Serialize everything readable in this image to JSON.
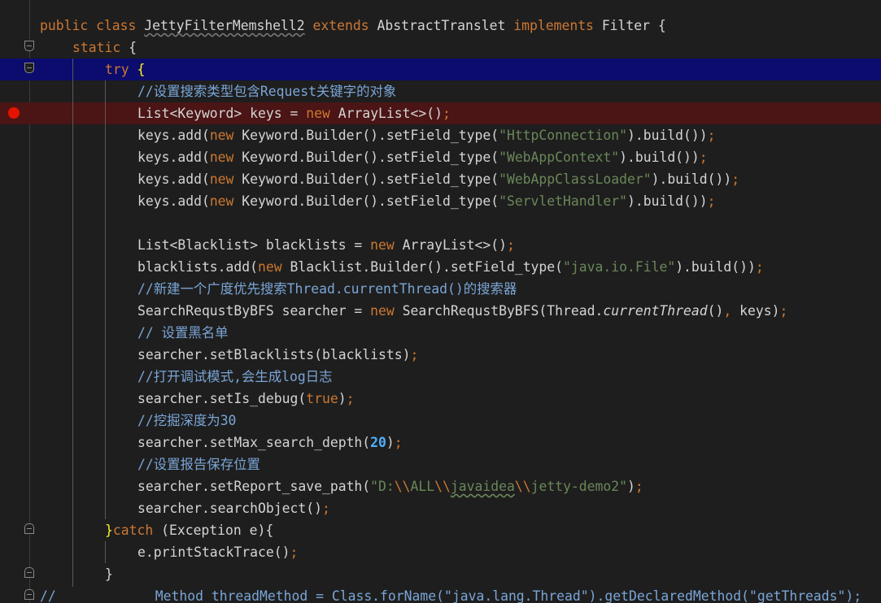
{
  "editor": {
    "lines": [
      {
        "id": "l1",
        "parts": [
          "public class ",
          "JettyFilterMemshell2",
          " extends ",
          "AbstractTranslet ",
          "implements ",
          "Filter {"
        ]
      },
      {
        "id": "l2",
        "parts": [
          "static ",
          "{"
        ]
      },
      {
        "id": "l3",
        "parts": [
          "try ",
          "{"
        ]
      },
      {
        "id": "l4",
        "parts": [
          "//设置搜索类型包含Request关键字的对象"
        ]
      },
      {
        "id": "l5",
        "parts": [
          "List<Keyword> keys = ",
          "new ",
          "ArrayList<>()",
          ";"
        ]
      },
      {
        "id": "l6",
        "parts": [
          "keys.add(",
          "new ",
          "Keyword.Builder().setField_type(",
          "\"HttpConnection\"",
          ").build())",
          ";"
        ]
      },
      {
        "id": "l7",
        "parts": [
          "keys.add(",
          "new ",
          "Keyword.Builder().setField_type(",
          "\"WebAppContext\"",
          ").build())",
          ";"
        ]
      },
      {
        "id": "l8",
        "parts": [
          "keys.add(",
          "new ",
          "Keyword.Builder().setField_type(",
          "\"WebAppClassLoader\"",
          ").build())",
          ";"
        ]
      },
      {
        "id": "l9",
        "parts": [
          "keys.add(",
          "new ",
          "Keyword.Builder().setField_type(",
          "\"ServletHandler\"",
          ").build())",
          ";"
        ]
      },
      {
        "id": "l11",
        "parts": [
          "List<Blacklist> blacklists = ",
          "new ",
          "ArrayList<>()",
          ";"
        ]
      },
      {
        "id": "l12",
        "parts": [
          "blacklists.add(",
          "new ",
          "Blacklist.Builder().setField_type(",
          "\"java.io.File\"",
          ").build())",
          ";"
        ]
      },
      {
        "id": "l13",
        "parts": [
          "//新建一个广度优先搜索Thread.currentThread()的搜索器"
        ]
      },
      {
        "id": "l14",
        "parts": [
          "SearchRequstByBFS searcher = ",
          "new ",
          "SearchRequstByBFS(Thread.",
          "currentThread",
          "()",
          ", ",
          "keys)",
          ";"
        ]
      },
      {
        "id": "l15",
        "parts": [
          "// 设置黑名单"
        ]
      },
      {
        "id": "l16",
        "parts": [
          "searcher.setBlacklists(blacklists)",
          ";"
        ]
      },
      {
        "id": "l17",
        "parts": [
          "//打开调试模式,会生成log日志"
        ]
      },
      {
        "id": "l18",
        "parts": [
          "searcher.setIs_debug(",
          "true",
          ")",
          ";"
        ]
      },
      {
        "id": "l19",
        "parts": [
          "//挖掘深度为30"
        ]
      },
      {
        "id": "l20",
        "parts": [
          "searcher.setMax_search_depth(",
          "20",
          ")",
          ";"
        ]
      },
      {
        "id": "l21",
        "parts": [
          "//设置报告保存位置"
        ]
      },
      {
        "id": "l22",
        "parts": [
          "searcher.setReport_save_path(",
          "\"D:",
          "\\\\",
          "ALL",
          "\\\\",
          "javaidea",
          "\\\\",
          "jetty-demo2\"",
          ")",
          ";"
        ]
      },
      {
        "id": "l23",
        "parts": [
          "searcher.searchObject()",
          ";"
        ]
      },
      {
        "id": "l24",
        "parts": [
          "}",
          "catch ",
          "(Exception e){"
        ]
      },
      {
        "id": "l25",
        "parts": [
          "e.printStackTrace()",
          ";"
        ]
      },
      {
        "id": "l26",
        "parts": [
          "}"
        ]
      },
      {
        "id": "l27",
        "parts": [
          "//",
          "Method threadMethod = Class.forName(\"java.lang.Thread\").getDeclaredMethod(\"getThreads\");"
        ]
      }
    ]
  },
  "colors": {
    "background": "#1e1e1e",
    "keyword": "#cc7832",
    "string": "#6a8759",
    "comment": "#7aa5d6",
    "current_line": "#0c0c6e",
    "breakpoint_line": "#4b1515",
    "breakpoint": "#e51400"
  }
}
